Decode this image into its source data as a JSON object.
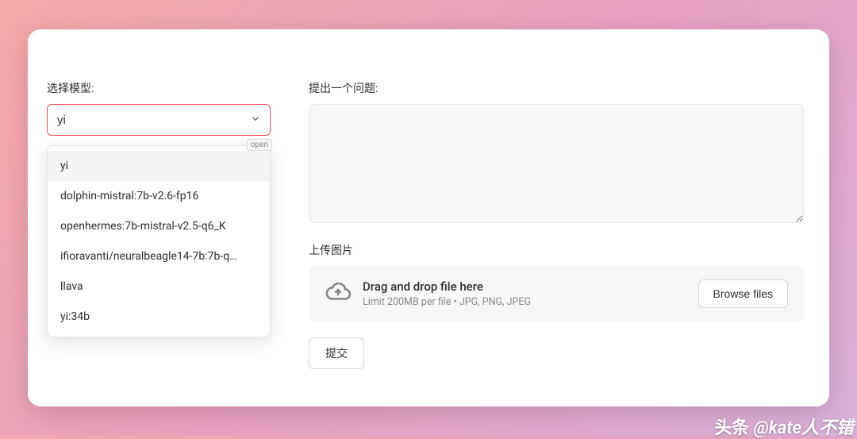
{
  "left": {
    "select_label": "选择模型:",
    "select_value": "yi",
    "badge": "open",
    "options": [
      "yi",
      "dolphin-mistral:7b-v2.6-fp16",
      "openhermes:7b-mistral-v2.5-q6_K",
      "ifioravanti/neuralbeagle14-7b:7b-q…",
      "llava",
      "yi:34b"
    ]
  },
  "right": {
    "question_label": "提出一个问题:",
    "upload_label": "上传图片",
    "upload_title": "Drag and drop file here",
    "upload_hint": "Limit 200MB per file • JPG, PNG, JPEG",
    "browse_label": "Browse files",
    "submit_label": "提交"
  },
  "watermark": {
    "brand": "头条",
    "handle": "@kate人不错"
  }
}
